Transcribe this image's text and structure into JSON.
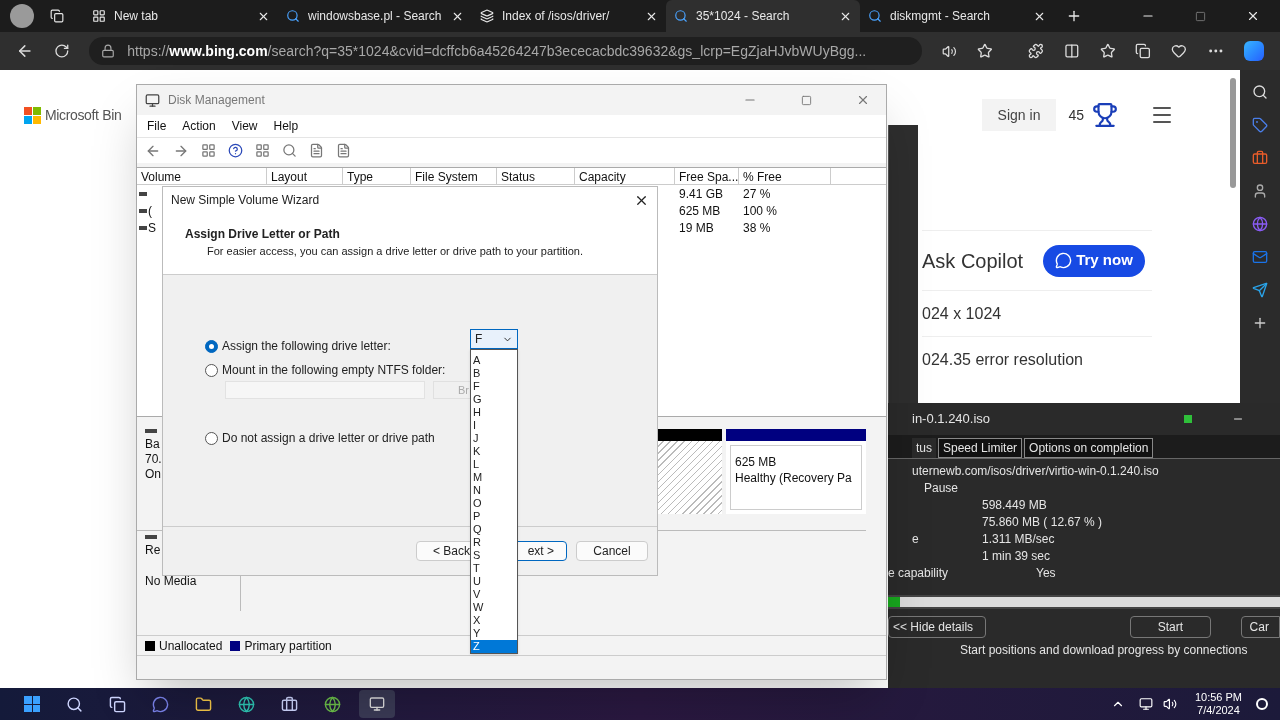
{
  "browser": {
    "tabs": [
      {
        "title": "New tab",
        "selected": false,
        "kind": "newtab"
      },
      {
        "title": "windowsbase.pl - Search",
        "selected": false,
        "kind": "search"
      },
      {
        "title": "Index of /isos/driver/",
        "selected": false,
        "kind": "folder"
      },
      {
        "title": "35*1024 - Search",
        "selected": true,
        "kind": "search"
      },
      {
        "title": "diskmgmt - Search",
        "selected": false,
        "kind": "search"
      }
    ],
    "url": "https://**www.bing.com**/search?q=35*1024&cvid=dcffcb6a45264247b3ececacbdc39632&gs_lcrp=EgZjaHJvbWUyBgg..."
  },
  "bing": {
    "logo": "Microsoft Bin",
    "sign_in": "Sign in",
    "points": "45",
    "copilot": "Ask Copilot",
    "try_now": "Try now",
    "suggestions": [
      "024 x 1024",
      "024.35 error resolution"
    ]
  },
  "disk_management": {
    "title": "Disk Management",
    "menu": [
      "File",
      "Action",
      "View",
      "Help"
    ],
    "columns": [
      "Volume",
      "Layout",
      "Type",
      "File System",
      "Status",
      "Capacity",
      "Free Spa...",
      "% Free"
    ],
    "rows": [
      {
        "free_space": "9.41 GB",
        "percent_free": "27 %"
      },
      {
        "volume": "(",
        "free_space": "625 MB",
        "percent_free": "100 %"
      },
      {
        "volume": "S",
        "free_space": "19 MB",
        "percent_free": "38 %"
      }
    ],
    "disks": [
      {
        "lines": [
          "Ba",
          "70.",
          "On"
        ]
      },
      {
        "lines": [
          "Re"
        ],
        "status": "No Media"
      }
    ],
    "partition": {
      "size": "625 MB",
      "status": "Healthy (Recovery Pa"
    },
    "legend": [
      {
        "label": "Unallocated",
        "color": "#000000"
      },
      {
        "label": "Primary partition",
        "color": "#000080"
      }
    ]
  },
  "wizard": {
    "title": "New Simple Volume Wizard",
    "heading": "Assign Drive Letter or Path",
    "subheading": "For easier access, you can assign a drive letter or drive path to your partition.",
    "options": [
      {
        "label": "Assign the following drive letter:",
        "selected": true
      },
      {
        "label": "Mount in the following empty NTFS folder:",
        "selected": false
      },
      {
        "label": "Do not assign a drive letter or drive path",
        "selected": false
      }
    ],
    "drive_letter": "F",
    "browse": "Br",
    "buttons": [
      "< Back",
      "ext >",
      "Cancel"
    ],
    "letters": [
      {
        "letter": "A",
        "selected": false
      },
      {
        "letter": "B",
        "selected": false
      },
      {
        "letter": "F",
        "selected": false
      },
      {
        "letter": "G",
        "selected": false
      },
      {
        "letter": "H",
        "selected": false
      },
      {
        "letter": "I",
        "selected": false
      },
      {
        "letter": "J",
        "selected": false
      },
      {
        "letter": "K",
        "selected": false
      },
      {
        "letter": "L",
        "selected": false
      },
      {
        "letter": "M",
        "selected": false
      },
      {
        "letter": "N",
        "selected": false
      },
      {
        "letter": "O",
        "selected": false
      },
      {
        "letter": "P",
        "selected": false
      },
      {
        "letter": "Q",
        "selected": false
      },
      {
        "letter": "R",
        "selected": false
      },
      {
        "letter": "S",
        "selected": false
      },
      {
        "letter": "T",
        "selected": false
      },
      {
        "letter": "U",
        "selected": false
      },
      {
        "letter": "V",
        "selected": false
      },
      {
        "letter": "W",
        "selected": false
      },
      {
        "letter": "X",
        "selected": false
      },
      {
        "letter": "Y",
        "selected": false
      },
      {
        "letter": "Z",
        "selected": true
      }
    ]
  },
  "download": {
    "title": "in-0.1.240.iso",
    "tabs": [
      {
        "label": "tus",
        "selected": true
      },
      {
        "label": "Speed Limiter",
        "selected": false
      },
      {
        "label": "Options on completion",
        "selected": false
      }
    ],
    "url": "uternewb.com/isos/driver/virtio-win-0.1.240.iso",
    "status": "Pause",
    "details": [
      {
        "value": "598.449 MB"
      },
      {
        "value": "75.860 MB ( 12.67 % )"
      },
      {
        "label": "e",
        "value": "1.311 MB/sec"
      },
      {
        "value": "1 min 39 sec"
      }
    ],
    "resume": {
      "label": "e capability",
      "value": "Yes"
    },
    "progress": {
      "level": 0.03
    },
    "buttons": [
      "<< Hide details",
      "Start",
      "Car"
    ],
    "footer": "Start positions and download progress by connections"
  },
  "taskbar": {
    "time": "10:56 PM",
    "date": "7/4/2024"
  }
}
